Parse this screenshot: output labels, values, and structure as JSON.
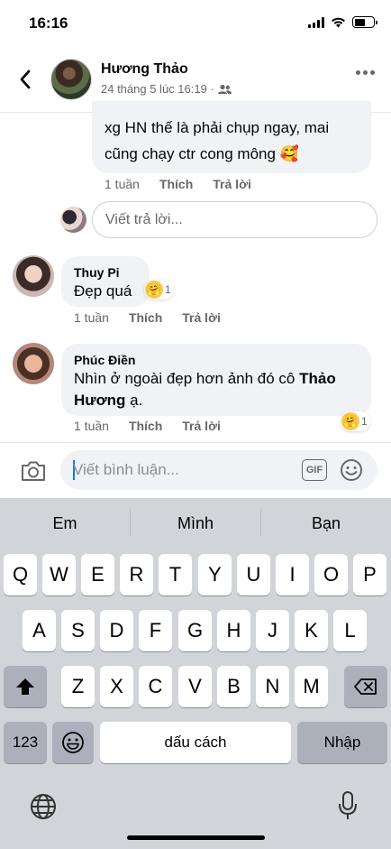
{
  "status": {
    "time": "16:16"
  },
  "header": {
    "name": "Hương Thảo",
    "meta": "24 tháng 5 lúc 16:19 ·"
  },
  "comments": [
    {
      "text_line1": "xg HN thế là phải chụp ngay, mai",
      "text_line2": "cũng chạy ctr cong mông 🥰",
      "time": "1 tuần",
      "like": "Thích",
      "reply": "Trả lời"
    },
    {
      "author": "Thuy Pi",
      "text": "Đẹp quá",
      "reaction_count": "1",
      "time": "1 tuần",
      "like": "Thích",
      "reply": "Trả lời"
    },
    {
      "author": "Phúc Điền",
      "text_line1_prefix": "Nhìn ở ngoài đẹp hơn ảnh đó cô ",
      "text_line1_bold": "Thảo",
      "text_line2_bold": "Hương",
      "text_line2_suffix": " ạ.",
      "reaction_count": "1",
      "time": "1 tuần",
      "like": "Thích",
      "reply": "Trả lời"
    }
  ],
  "reply_input": {
    "placeholder": "Viết trả lời..."
  },
  "composer": {
    "placeholder": "Viết bình luận...",
    "gif_label": "GIF"
  },
  "keyboard": {
    "suggestions": [
      "Em",
      "Mình",
      "Bạn"
    ],
    "row1": [
      "Q",
      "W",
      "E",
      "R",
      "T",
      "Y",
      "U",
      "I",
      "O",
      "P"
    ],
    "row2": [
      "A",
      "S",
      "D",
      "F",
      "G",
      "H",
      "J",
      "K",
      "L"
    ],
    "row3": [
      "Z",
      "X",
      "C",
      "V",
      "B",
      "N",
      "M"
    ],
    "numbers_label": "123",
    "space_label": "dấu cách",
    "return_label": "Nhập"
  }
}
